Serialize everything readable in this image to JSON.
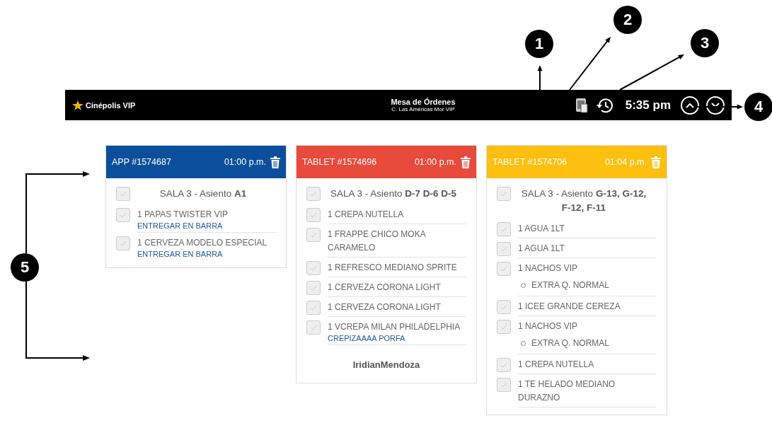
{
  "header": {
    "logo": "Cinépolis VIP",
    "title": "Mesa de Órdenes",
    "subtitle": "C. Las Américas Mor VIP",
    "time": "5:35 pm"
  },
  "callouts": [
    "1",
    "2",
    "3",
    "4",
    "5"
  ],
  "orders": [
    {
      "source": "APP #1574687",
      "time": "01:00 p.m.",
      "color": "#0b4f9c",
      "seat": "SALA 3 - Asiento **A1**",
      "items": [
        {
          "text": "1 PAPAS TWISTER VIP",
          "note": "ENTREGAR EN BARRA"
        },
        {
          "text": "1 CERVEZA MODELO ESPECIAL",
          "note": "ENTREGAR EN BARRA"
        }
      ]
    },
    {
      "source": "TABLET #1574696",
      "time": "01:00 p.m.",
      "color": "#e84a3c",
      "seat": "SALA 3 - Asiento **D-7 D-6 D-5**",
      "user": "IridianMendoza",
      "items": [
        {
          "text": "1 CREPA NUTELLA"
        },
        {
          "text": "1 FRAPPE CHICO MOKA CARAMELO"
        },
        {
          "text": "1 REFRESCO MEDIANO SPRITE"
        },
        {
          "text": "1 CERVEZA CORONA LIGHT"
        },
        {
          "text": "1 CERVEZA CORONA LIGHT"
        },
        {
          "text": "1 VCREPA MILAN PHILADELPHIA",
          "note": "CREPIZAAAA PORFA"
        }
      ]
    },
    {
      "source": "TABLET #1574706",
      "time": "01:04 p.m.",
      "color": "#fdbf10",
      "seat": "SALA 3 - Asiento **G-13, G-12, F-12, F-11**",
      "items": [
        {
          "text": "1 AGUA 1LT"
        },
        {
          "text": "1 AGUA 1LT"
        },
        {
          "text": "1 NACHOS VIP",
          "extras": [
            "EXTRA Q. NORMAL"
          ]
        },
        {
          "text": "1 ICEE GRANDE CEREZA"
        },
        {
          "text": "1 NACHOS VIP",
          "extras": [
            "EXTRA Q. NORMAL"
          ]
        },
        {
          "text": "1 CREPA NUTELLA"
        },
        {
          "text": "1 TE HELADO MEDIANO DURAZNO"
        }
      ]
    }
  ]
}
